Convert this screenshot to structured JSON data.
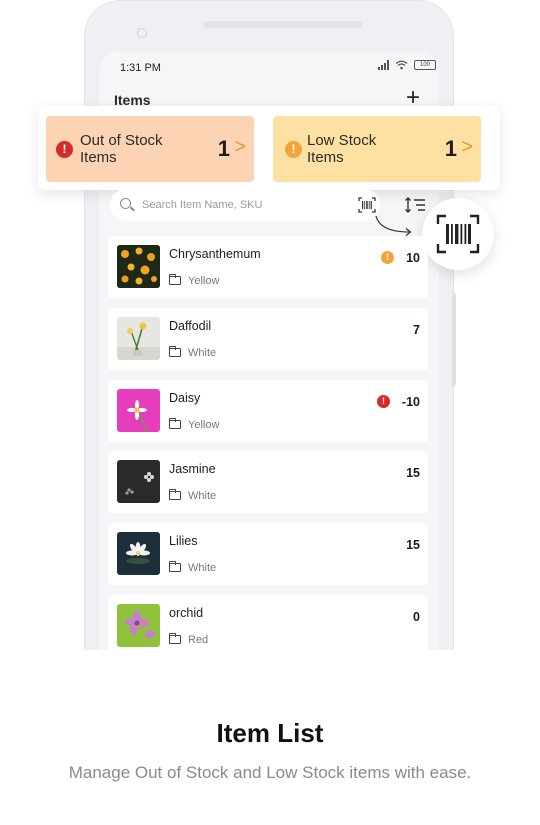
{
  "status_bar": {
    "time": "1:31 PM",
    "battery": "100"
  },
  "header": {
    "title": "Items",
    "add_label": "+"
  },
  "stock_cards": [
    {
      "label": "Out of Stock Items",
      "count": "1",
      "icon": "!",
      "color": "#fcd3b3"
    },
    {
      "label": "Low Stock Items",
      "count": "1",
      "icon": "!",
      "color": "#fde1a2"
    }
  ],
  "search": {
    "placeholder": "Search Item Name, SKU",
    "value": ""
  },
  "items": [
    {
      "name": "Chrysanthemum",
      "category": "Yellow",
      "qty": "10",
      "badge": "low"
    },
    {
      "name": "Daffodil",
      "category": "White",
      "qty": "7",
      "badge": ""
    },
    {
      "name": "Daisy",
      "category": "Yellow",
      "qty": "-10",
      "badge": "out"
    },
    {
      "name": "Jasmine",
      "category": "White",
      "qty": "15",
      "badge": ""
    },
    {
      "name": "Lilies",
      "category": "White",
      "qty": "15",
      "badge": ""
    },
    {
      "name": "orchid",
      "category": "Red",
      "qty": "0",
      "badge": ""
    }
  ],
  "caption": {
    "title": "Item List",
    "subtitle": "Manage Out of Stock and Low Stock items with ease."
  },
  "colors": {
    "out_of_stock": "#d72a2a",
    "low_stock": "#f2a43b"
  }
}
